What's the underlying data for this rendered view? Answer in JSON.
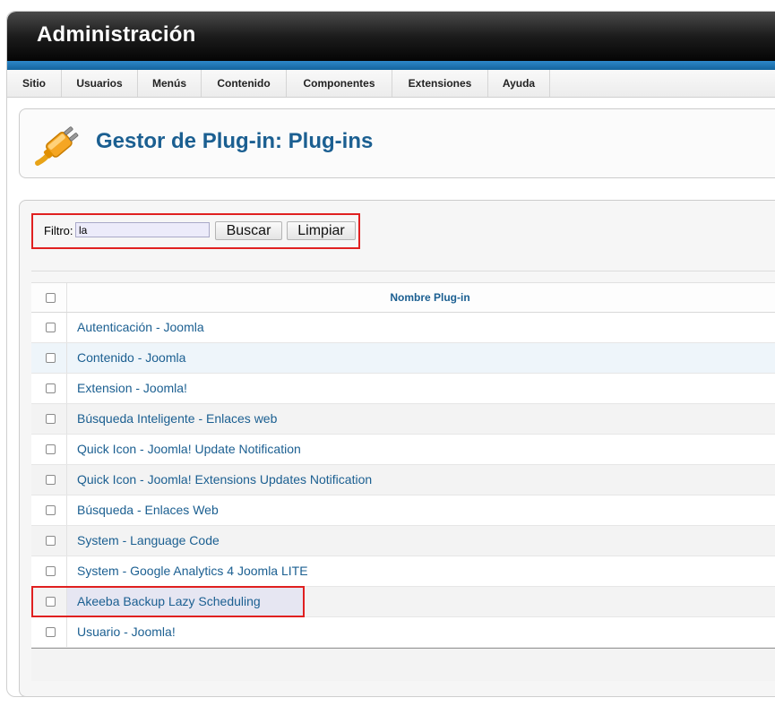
{
  "header": {
    "title": "Administración"
  },
  "menu": {
    "items": [
      {
        "label": "Sitio"
      },
      {
        "label": "Usuarios"
      },
      {
        "label": "Menús"
      },
      {
        "label": "Contenido"
      },
      {
        "label": "Componentes"
      },
      {
        "label": "Extensiones"
      },
      {
        "label": "Ayuda"
      }
    ]
  },
  "page": {
    "title": "Gestor de Plug-in: Plug-ins",
    "icon": "plugin-plug-icon"
  },
  "filter": {
    "label": "Filtro:",
    "value": "la",
    "search_label": "Buscar",
    "clear_label": "Limpiar"
  },
  "table": {
    "column_name": "Nombre Plug-in",
    "rows": [
      {
        "name": "Autenticación - Joomla"
      },
      {
        "name": "Contenido - Joomla"
      },
      {
        "name": "Extension - Joomla!"
      },
      {
        "name": "Búsqueda Inteligente - Enlaces web"
      },
      {
        "name": "Quick Icon - Joomla! Update Notification"
      },
      {
        "name": "Quick Icon - Joomla! Extensions Updates Notification"
      },
      {
        "name": "Búsqueda - Enlaces Web"
      },
      {
        "name": "System - Language Code"
      },
      {
        "name": "System - Google Analytics 4 Joomla LITE"
      },
      {
        "name": "Akeeba Backup Lazy Scheduling"
      },
      {
        "name": "Usuario - Joomla!"
      }
    ]
  },
  "colors": {
    "accent": "#1b5f91",
    "highlight_border": "#e02020",
    "header_blue": "#2d87c8"
  }
}
